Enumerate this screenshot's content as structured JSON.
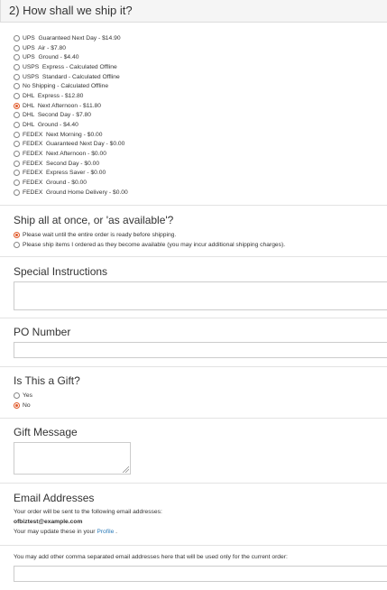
{
  "shipping": {
    "title": "2) How shall we ship it?",
    "options": [
      {
        "label": "UPS  Guaranteed Next Day - $14.90",
        "checked": false
      },
      {
        "label": "UPS  Air - $7.80",
        "checked": false
      },
      {
        "label": "UPS  Ground - $4.40",
        "checked": false
      },
      {
        "label": "USPS  Express - Calculated Offline",
        "checked": false
      },
      {
        "label": "USPS  Standard - Calculated Offline",
        "checked": false
      },
      {
        "label": "No Shipping - Calculated Offline",
        "checked": false
      },
      {
        "label": "DHL  Express - $12.80",
        "checked": false
      },
      {
        "label": "DHL  Next Afternoon - $11.80",
        "checked": true
      },
      {
        "label": "DHL  Second Day - $7.80",
        "checked": false
      },
      {
        "label": "DHL  Ground - $4.40",
        "checked": false
      },
      {
        "label": "FEDEX  Next Morning - $0.00",
        "checked": false
      },
      {
        "label": "FEDEX  Guaranteed Next Day - $0.00",
        "checked": false
      },
      {
        "label": "FEDEX  Next Afternoon - $0.00",
        "checked": false
      },
      {
        "label": "FEDEX  Second Day - $0.00",
        "checked": false
      },
      {
        "label": "FEDEX  Express Saver - $0.00",
        "checked": false
      },
      {
        "label": "FEDEX  Ground - $0.00",
        "checked": false
      },
      {
        "label": "FEDEX  Ground Home Delivery - $0.00",
        "checked": false
      }
    ]
  },
  "split": {
    "title": "Ship all at once, or 'as available'?",
    "option_wait": "Please wait until the entire order is ready before shipping.",
    "option_available": "Please ship items I ordered as they become available (you may incur additional shipping charges).",
    "wait_checked": true
  },
  "instructions": {
    "title": "Special Instructions",
    "value": ""
  },
  "po": {
    "title": "PO Number",
    "value": ""
  },
  "gift": {
    "title": "Is This a Gift?",
    "yes": "Yes",
    "no": "No",
    "no_checked": true
  },
  "gift_message": {
    "title": "Gift Message",
    "value": ""
  },
  "email": {
    "title": "Email Addresses",
    "intro": "Your order will be sent to the following email addresses:",
    "address": "ofbiztest@example.com",
    "update_prefix": "Your may update these in your ",
    "profile_link": "Profile",
    "update_suffix": " .",
    "additional_label": "You may add other comma separated email addresses here that will be used only for the current order:",
    "additional_value": ""
  },
  "colors": {
    "accent": "#e05a2a",
    "link": "#2a7ab8",
    "header_bg": "#f5f5f5"
  }
}
